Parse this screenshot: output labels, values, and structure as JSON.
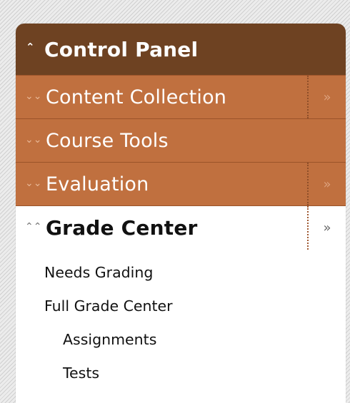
{
  "control_panel": {
    "title": "Control Panel",
    "collapse_icon": "double-chevron-up-icon",
    "sections": [
      {
        "label": "Content Collection",
        "toggle_icon": "double-chevron-down-icon",
        "has_expand": true
      },
      {
        "label": "Course Tools",
        "toggle_icon": "double-chevron-down-icon",
        "has_expand": false
      },
      {
        "label": "Evaluation",
        "toggle_icon": "double-chevron-down-icon",
        "has_expand": true
      }
    ],
    "grade_center": {
      "label": "Grade Center",
      "toggle_icon": "double-chevron-up-icon",
      "items": [
        {
          "label": "Needs Grading",
          "level": 1
        },
        {
          "label": "Full Grade Center",
          "level": 1
        },
        {
          "label": "Assignments",
          "level": 2
        },
        {
          "label": "Tests",
          "level": 2
        }
      ]
    }
  },
  "colors": {
    "header_bg": "#6e4222",
    "section_bg": "#c0703f",
    "section_border": "#9a5329",
    "text_light": "#ffffff",
    "text_dark": "#111111"
  }
}
